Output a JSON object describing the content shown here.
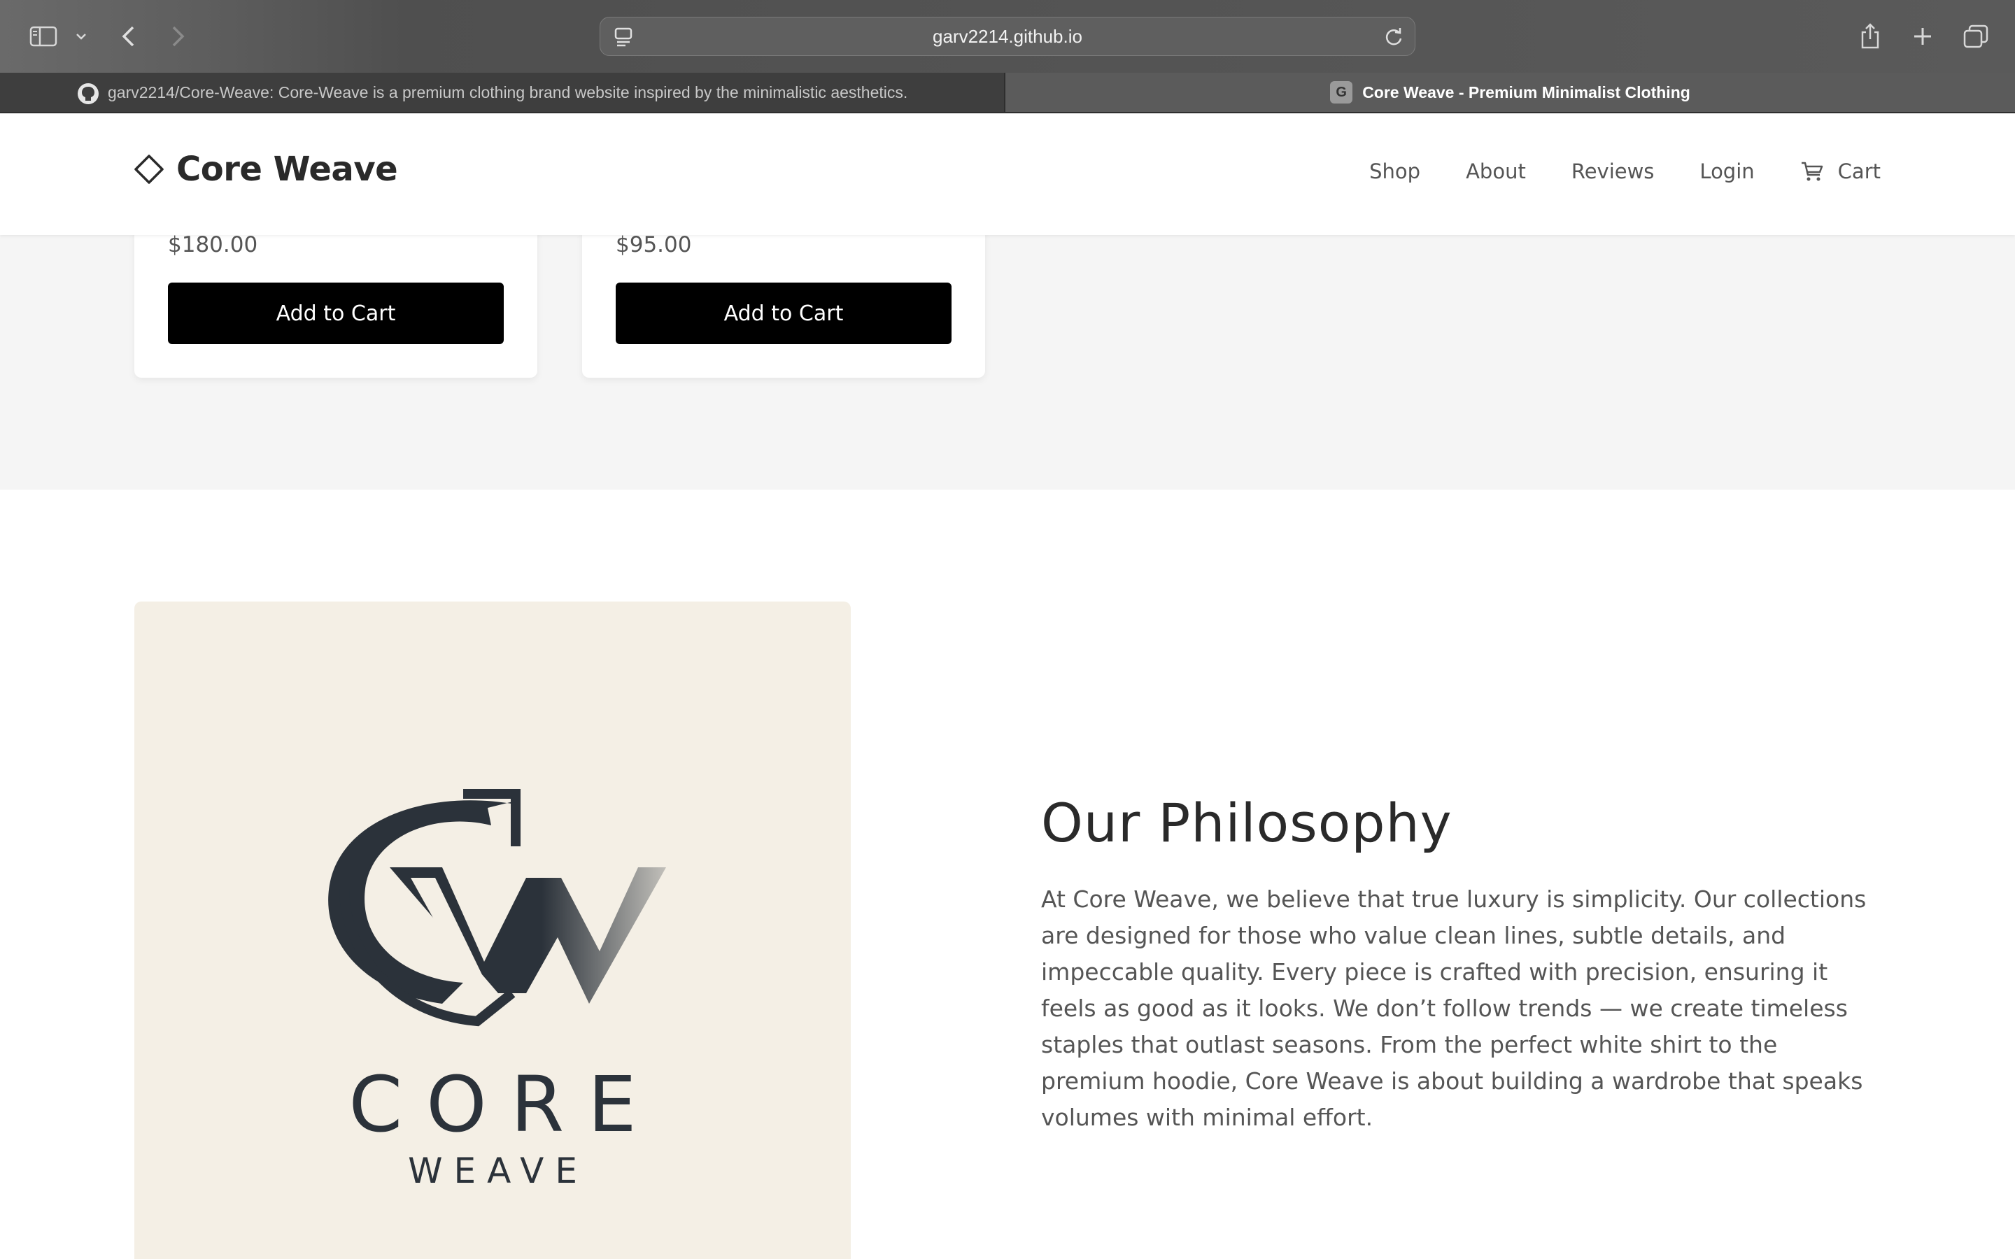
{
  "browser": {
    "url": "garv2214.github.io",
    "tabs": [
      {
        "title": "garv2214/Core-Weave: Core-Weave is a premium clothing brand website inspired by the minimalistic aesthetics.",
        "active": false
      },
      {
        "title": "Core Weave - Premium Minimalist Clothing",
        "favicon_letter": "G",
        "active": true
      }
    ],
    "icons": [
      "sidebar-icon",
      "chevron-down-icon",
      "back-icon",
      "forward-icon",
      "reader-icon",
      "reload-icon",
      "share-icon",
      "new-tab-icon",
      "tab-overview-icon"
    ]
  },
  "header": {
    "brand": "Core Weave",
    "nav": {
      "shop": "Shop",
      "about": "About",
      "reviews": "Reviews",
      "login": "Login",
      "cart": "Cart"
    }
  },
  "products": [
    {
      "price": "$180.00",
      "button": "Add to Cart"
    },
    {
      "price": "$95.00",
      "button": "Add to Cart"
    }
  ],
  "philosophy": {
    "title": "Our Philosophy",
    "body": "At Core Weave, we believe that true luxury is simplicity. Our collections are designed for those who value clean lines, subtle details, and impeccable quality. Every piece is crafted with precision, ensuring it feels as good as it looks. We don’t follow trends — we create timeless staples that outlast seasons. From the perfect white shirt to the premium hoodie, Core Weave is about building a wardrobe that speaks volumes with minimal effort.",
    "logo": {
      "line1": "CORE",
      "line2": "WEAVE"
    }
  },
  "colors": {
    "button_bg": "#000000",
    "logo_bg": "#f4efe5",
    "logo_ink": "#2b323a"
  }
}
